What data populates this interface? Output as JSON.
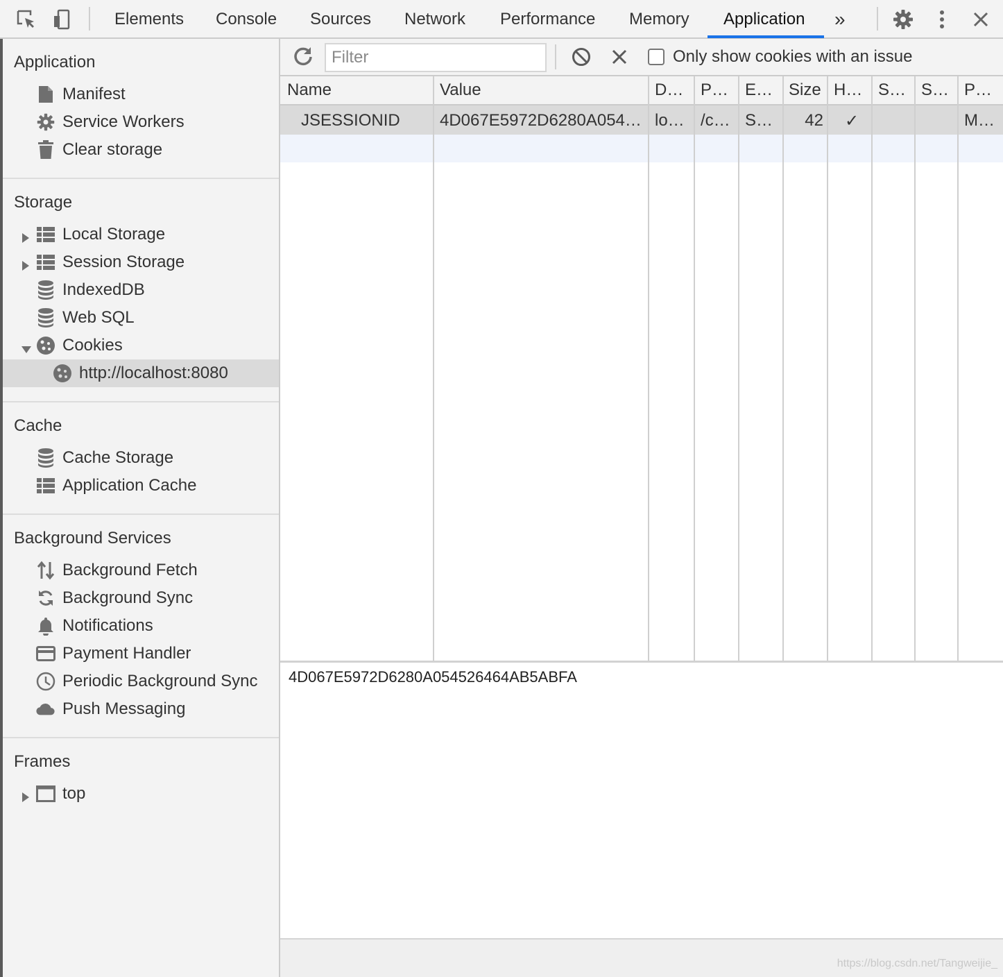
{
  "topbar": {
    "tabs": [
      "Elements",
      "Console",
      "Sources",
      "Network",
      "Performance",
      "Memory",
      "Application"
    ],
    "more": "»"
  },
  "sidebar": {
    "application": {
      "title": "Application",
      "items": [
        "Manifest",
        "Service Workers",
        "Clear storage"
      ]
    },
    "storage": {
      "title": "Storage",
      "items": [
        "Local Storage",
        "Session Storage",
        "IndexedDB",
        "Web SQL",
        "Cookies"
      ],
      "cookie_origin": "http://localhost:8080"
    },
    "cache": {
      "title": "Cache",
      "items": [
        "Cache Storage",
        "Application Cache"
      ]
    },
    "background": {
      "title": "Background Services",
      "items": [
        "Background Fetch",
        "Background Sync",
        "Notifications",
        "Payment Handler",
        "Periodic Background Sync",
        "Push Messaging"
      ]
    },
    "frames": {
      "title": "Frames",
      "items": [
        "top"
      ]
    }
  },
  "toolbar": {
    "filter_placeholder": "Filter",
    "checkbox_label": "Only show cookies with an issue"
  },
  "table": {
    "headers": [
      "Name",
      "Value",
      "D…",
      "P…",
      "E…",
      "Size",
      "H…",
      "S…",
      "S…",
      "P…"
    ],
    "rows": [
      [
        "JSESSIONID",
        "4D067E5972D6280A054…",
        "lo…",
        "/c…",
        "S…",
        "42",
        "✓",
        "",
        "",
        "M…"
      ]
    ]
  },
  "preview": {
    "value": "4D067E5972D6280A054526464AB5ABFA"
  },
  "watermark": "https://blog.csdn.net/Tangweijie_"
}
